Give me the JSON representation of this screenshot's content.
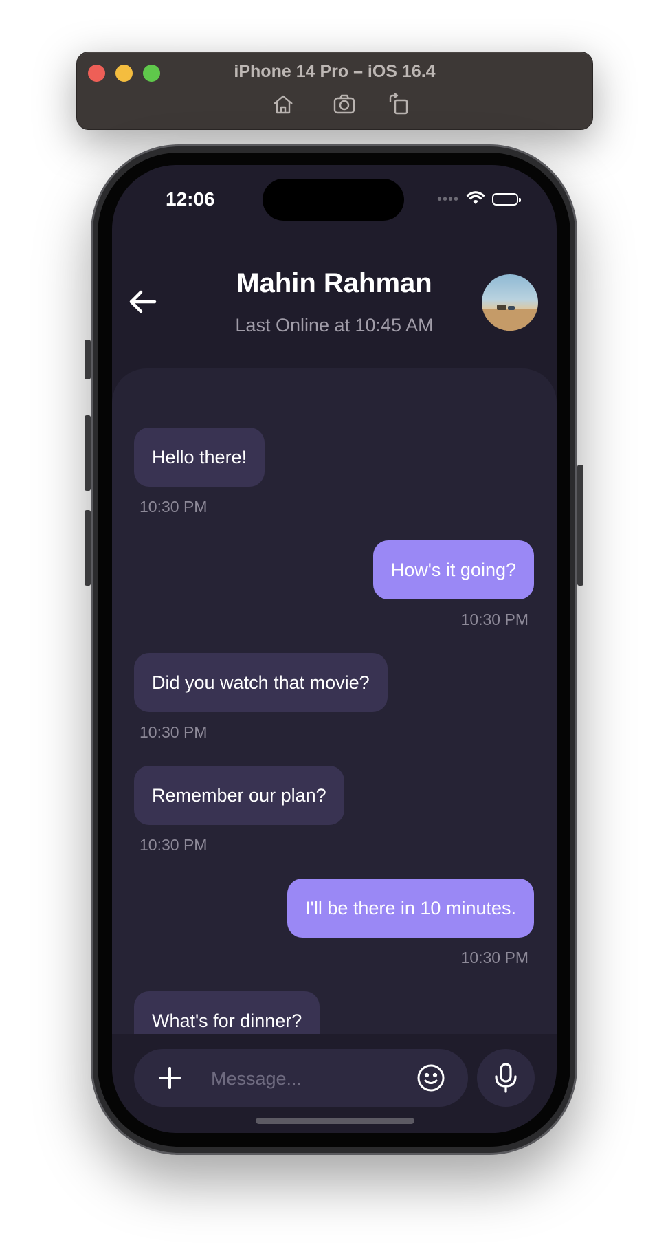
{
  "simulator": {
    "title": "iPhone 14 Pro – iOS 16.4",
    "tools": [
      "home-icon",
      "screenshot-icon",
      "rotate-icon"
    ]
  },
  "status_bar": {
    "time": "12:06",
    "signal": "••••"
  },
  "header": {
    "contact_name": "Mahin Rahman",
    "status": "Last Online at 10:45 AM"
  },
  "messages": [
    {
      "direction": "incoming",
      "text": "Hello there!",
      "time": "10:30 PM"
    },
    {
      "direction": "outgoing",
      "text": "How's it going?",
      "time": "10:30 PM"
    },
    {
      "direction": "incoming",
      "text": "Did you watch that movie?",
      "time": "10:30 PM"
    },
    {
      "direction": "incoming",
      "text": "Remember our plan?",
      "time": "10:30 PM"
    },
    {
      "direction": "outgoing",
      "text": "I'll be there in 10 minutes.",
      "time": "10:30 PM"
    },
    {
      "direction": "incoming",
      "text": "What's for dinner?",
      "time": ""
    }
  ],
  "composer": {
    "placeholder": "Message...",
    "value": ""
  },
  "colors": {
    "background": "#1f1c2b",
    "incoming_bubble": "#393352",
    "outgoing_bubble": "#9a88f5"
  }
}
